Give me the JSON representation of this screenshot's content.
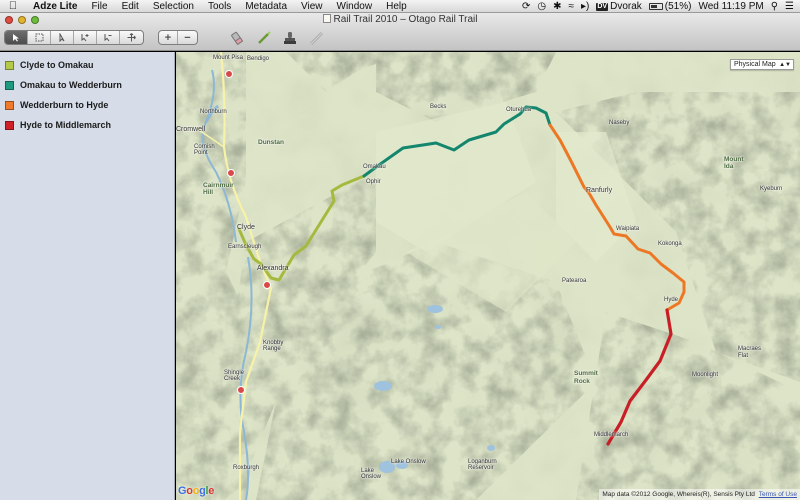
{
  "menubar": {
    "app_name": "Adze Lite",
    "items": [
      "File",
      "Edit",
      "Selection",
      "Tools",
      "Metadata",
      "View",
      "Window",
      "Help"
    ],
    "input_badge": "DV",
    "input_source": "Dvorak",
    "battery": "(51%)",
    "clock": "Wed 11:19 PM"
  },
  "window": {
    "title": "Rail Trail 2010 – Otago Rail Trail"
  },
  "toolbar": {
    "zoom_in": "+",
    "zoom_out": "−"
  },
  "sidebar": {
    "tracks": [
      {
        "label": "Clyde to Omakau",
        "color": "#b4c94a"
      },
      {
        "label": "Omakau to Wedderburn",
        "color": "#1f9a80"
      },
      {
        "label": "Wedderburn to Hyde",
        "color": "#ef7a2b"
      },
      {
        "label": "Hyde to Middlemarch",
        "color": "#cf2027"
      }
    ]
  },
  "map": {
    "type_selector": "Physical Map",
    "places": [
      "Mount Pisa",
      "Bendigo",
      "Northburn",
      "Cromwell",
      "Cornish Point",
      "Dunstan",
      "Cairnmuir Hill",
      "Clyde",
      "Alexandra",
      "Earnscleugh",
      "Becks",
      "Oturehua",
      "Naseby",
      "Omakau",
      "Ophir",
      "Ranfurly",
      "Waipiata",
      "Kokonga",
      "Patearoa",
      "Hyde",
      "Mount Ida",
      "Kyeburn",
      "Macraes Flat",
      "Moonlight",
      "Summit Rock",
      "Middlemarch",
      "Shingle Creek",
      "Knobby Range",
      "Roxburgh",
      "Lake Onslow",
      "Loganburn Reservoir",
      "Lake Onslow"
    ],
    "google_letters": [
      "G",
      "o",
      "o",
      "g",
      "l",
      "e"
    ],
    "attribution": "Map data ©2012 Google, Whereis(R), Sensis Pty Ltd",
    "terms": "Terms of Use"
  }
}
